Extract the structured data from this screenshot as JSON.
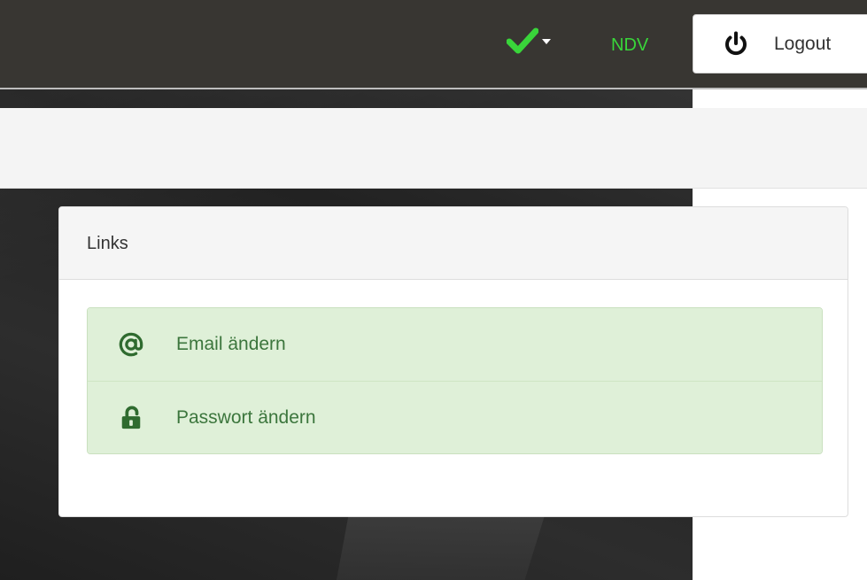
{
  "topbar": {
    "status_icon": "check-icon",
    "status_color": "#39d53a",
    "user_label": "NDV",
    "logout_label": "Logout",
    "logout_icon": "power-icon"
  },
  "panel": {
    "heading": "Links",
    "items": [
      {
        "label": "Email ändern",
        "icon": "at-icon"
      },
      {
        "label": "Passwort ändern",
        "icon": "unlock-icon"
      }
    ]
  },
  "colors": {
    "topbar_bg": "#383632",
    "item_bg": "#dff0d8",
    "item_text": "#3c763d"
  }
}
